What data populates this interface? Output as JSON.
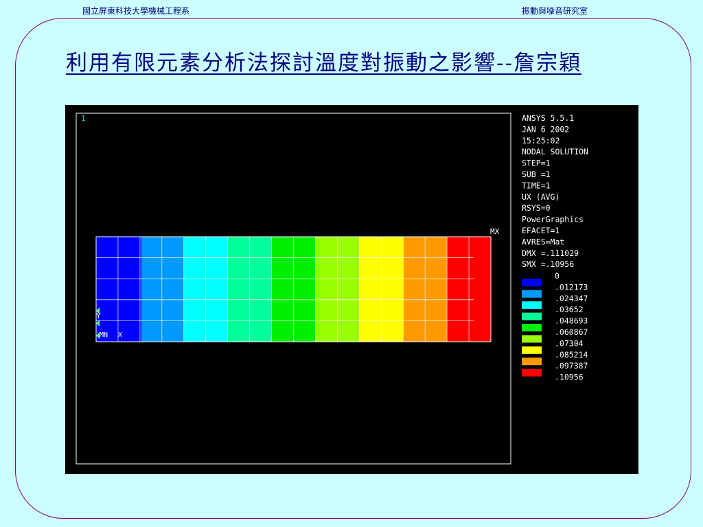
{
  "header": {
    "left": "國立屏東科技大學機械工程系",
    "right": "振動與噪音研究室"
  },
  "slide": {
    "title": "利用有限元素分析法探討溫度對振動之影響--詹宗穎"
  },
  "ansys": {
    "window_number": "1",
    "info_lines": [
      "ANSYS 5.5.1",
      "JAN  6 2002",
      "15:25:02",
      "NODAL SOLUTION",
      "STEP=1",
      "SUB =1",
      "TIME=1",
      "UX        (AVG)",
      "RSYS=0",
      "PowerGraphics",
      "EFACET=1",
      "AVRES=Mat",
      "DMX =.111029",
      "SMX =.10956"
    ],
    "legend": [
      {
        "label": "0",
        "color": null
      },
      {
        "label": ".012173",
        "color": "#0000ff"
      },
      {
        "label": ".024347",
        "color": "#0099ff"
      },
      {
        "label": ".03652",
        "color": "#00ffff"
      },
      {
        "label": ".048693",
        "color": "#00ff99"
      },
      {
        "label": ".060867",
        "color": "#00ee00"
      },
      {
        "label": ".07304",
        "color": "#99ff00"
      },
      {
        "label": ".085214",
        "color": "#ffff00"
      },
      {
        "label": ".097387",
        "color": "#ff9900"
      },
      {
        "label": ".10956",
        "color": "#ff0000"
      }
    ],
    "contour_colors": [
      "#0000ff",
      "#0099ff",
      "#00ffff",
      "#00ff99",
      "#00ee00",
      "#99ff00",
      "#ffff00",
      "#ff9900",
      "#ff0000"
    ],
    "mx_label": "MX",
    "mn_label": "MN",
    "axis_y_label": "Y",
    "axis_x_label": "X"
  }
}
